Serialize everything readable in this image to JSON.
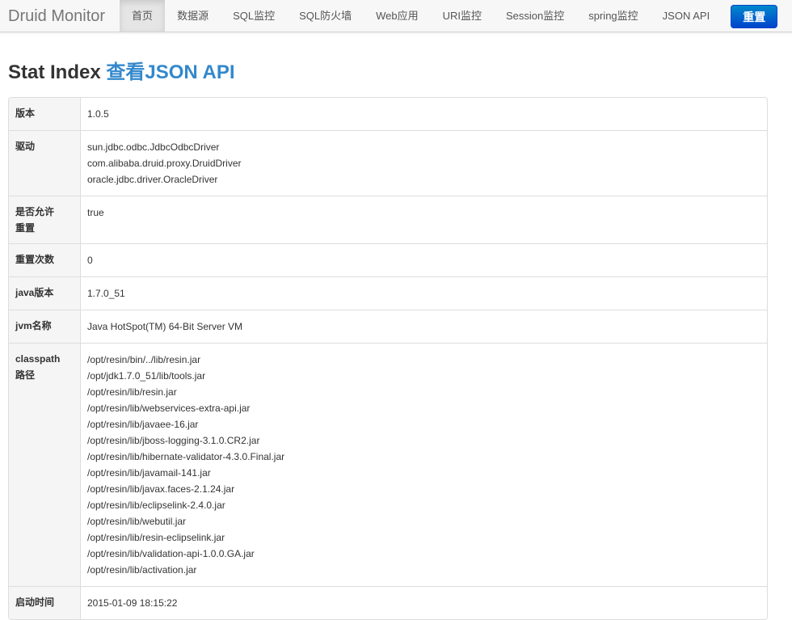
{
  "navbar": {
    "brand": "Druid Monitor",
    "items": [
      "首页",
      "数据源",
      "SQL监控",
      "SQL防火墙",
      "Web应用",
      "URI监控",
      "Session监控",
      "spring监控",
      "JSON API"
    ],
    "active_index": 0,
    "reset_label": "重置"
  },
  "header": {
    "title": "Stat Index",
    "link": "查看JSON API"
  },
  "stats": [
    {
      "label": "版本",
      "values": [
        "1.0.5"
      ]
    },
    {
      "label": "驱动",
      "values": [
        "sun.jdbc.odbc.JdbcOdbcDriver",
        "com.alibaba.druid.proxy.DruidDriver",
        "oracle.jdbc.driver.OracleDriver"
      ]
    },
    {
      "label_lines": [
        "是否允许",
        "重置"
      ],
      "values": [
        "true"
      ]
    },
    {
      "label": "重置次数",
      "values": [
        "0"
      ]
    },
    {
      "label": "java版本",
      "values": [
        "1.7.0_51"
      ]
    },
    {
      "label": "jvm名称",
      "values": [
        "Java HotSpot(TM) 64-Bit Server VM"
      ]
    },
    {
      "label_lines": [
        "classpath",
        "路径"
      ],
      "values": [
        "/opt/resin/bin/../lib/resin.jar",
        "/opt/jdk1.7.0_51/lib/tools.jar",
        "/opt/resin/lib/resin.jar",
        "/opt/resin/lib/webservices-extra-api.jar",
        "/opt/resin/lib/javaee-16.jar",
        "/opt/resin/lib/jboss-logging-3.1.0.CR2.jar",
        "/opt/resin/lib/hibernate-validator-4.3.0.Final.jar",
        "/opt/resin/lib/javamail-141.jar",
        "/opt/resin/lib/javax.faces-2.1.24.jar",
        "/opt/resin/lib/eclipselink-2.4.0.jar",
        "/opt/resin/lib/webutil.jar",
        "/opt/resin/lib/resin-eclipselink.jar",
        "/opt/resin/lib/validation-api-1.0.0.GA.jar",
        "/opt/resin/lib/activation.jar"
      ]
    },
    {
      "label": "启动时间",
      "values": [
        "2015-01-09 18:15:22"
      ]
    }
  ]
}
